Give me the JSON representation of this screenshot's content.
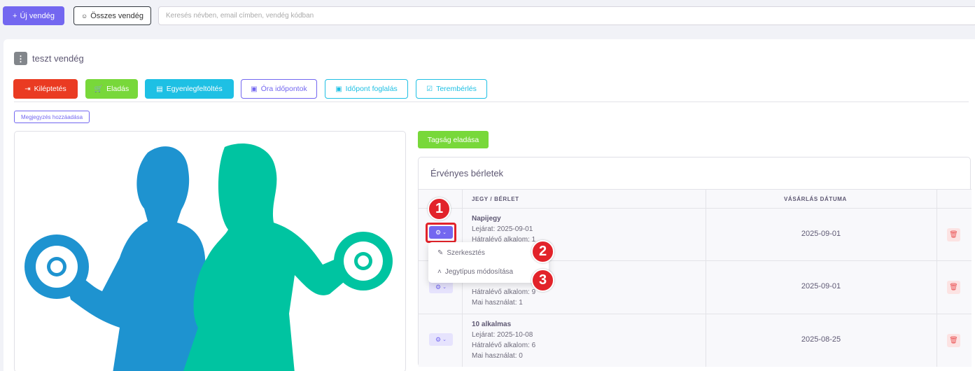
{
  "topbar": {
    "new_guest_label": "Új vendég",
    "all_guests_label": "Összes vendég",
    "search_placeholder": "Keresés névben, email címben, vendég kódban"
  },
  "guest": {
    "name": "teszt vendég"
  },
  "actions": {
    "checkout": "Kiléptetés",
    "sale": "Eladás",
    "topup": "Egyenlegfeltöltés",
    "class_times": "Óra időpontok",
    "book_slot": "Időpont foglalás",
    "room_rental": "Terembérlés"
  },
  "add_note_label": "Megjegyzés hozzáadása",
  "sell_membership_label": "Tagság eladása",
  "passes": {
    "title": "Érvényes bérletek",
    "columns": {
      "ticket": "JEGY / BÉRLET",
      "purchase_date": "VÁSÁRLÁS DÁTUMA"
    },
    "rows": [
      {
        "name": "Napijegy",
        "expiry": "Lejárat: 2025-09-01",
        "remaining": "Hátralévő alkalom: 1",
        "date": "2025-09-01"
      },
      {
        "remaining": "Hátralévő alkalom: 9",
        "today": "Mai használat: 1",
        "date": "2025-09-01"
      },
      {
        "name": "10 alkalmas",
        "expiry": "Lejárat: 2025-10-08",
        "remaining": "Hátralévő alkalom: 6",
        "today": "Mai használat: 0",
        "date": "2025-08-25"
      }
    ]
  },
  "dropdown": {
    "edit": "Szerkesztés",
    "change_type": "Jegytípus módosítása"
  },
  "badges": {
    "b1": "1",
    "b2": "2",
    "b3": "3"
  },
  "colors": {
    "primary": "#7367f0",
    "danger": "#ea3b22",
    "success": "#78d83a",
    "info": "#1ec0e4",
    "man": "#1e93d0",
    "woman": "#00c4a1"
  },
  "icons": {
    "gear": "gear-icon",
    "trash": "trash-icon",
    "pencil": "pencil-icon",
    "chevrons": "chevrons-up-icon"
  }
}
